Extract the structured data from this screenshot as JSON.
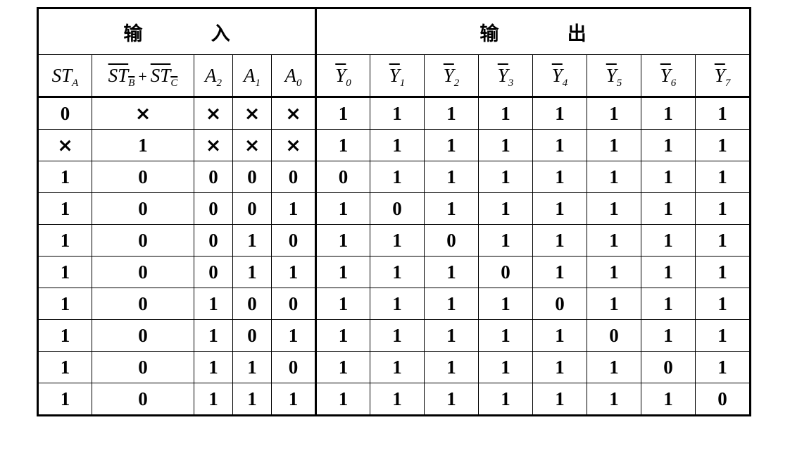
{
  "groups": {
    "input": "输 入",
    "output": "输 出"
  },
  "headers": {
    "st_a": {
      "main": "ST",
      "sub": "A"
    },
    "st_bc": {
      "left_main": "ST",
      "left_sub": "B",
      "plus": "+",
      "right_main": "ST",
      "right_sub": "C"
    },
    "a2": {
      "main": "A",
      "sub": "2"
    },
    "a1": {
      "main": "A",
      "sub": "1"
    },
    "a0": {
      "main": "A",
      "sub": "0"
    },
    "outputs": [
      {
        "main": "Y",
        "sub": "0"
      },
      {
        "main": "Y",
        "sub": "1"
      },
      {
        "main": "Y",
        "sub": "2"
      },
      {
        "main": "Y",
        "sub": "3"
      },
      {
        "main": "Y",
        "sub": "4"
      },
      {
        "main": "Y",
        "sub": "5"
      },
      {
        "main": "Y",
        "sub": "6"
      },
      {
        "main": "Y",
        "sub": "7"
      }
    ]
  },
  "rows": [
    [
      "0",
      "×",
      "×",
      "×",
      "×",
      "1",
      "1",
      "1",
      "1",
      "1",
      "1",
      "1",
      "1"
    ],
    [
      "×",
      "1",
      "×",
      "×",
      "×",
      "1",
      "1",
      "1",
      "1",
      "1",
      "1",
      "1",
      "1"
    ],
    [
      "1",
      "0",
      "0",
      "0",
      "0",
      "0",
      "1",
      "1",
      "1",
      "1",
      "1",
      "1",
      "1"
    ],
    [
      "1",
      "0",
      "0",
      "0",
      "1",
      "1",
      "0",
      "1",
      "1",
      "1",
      "1",
      "1",
      "1"
    ],
    [
      "1",
      "0",
      "0",
      "1",
      "0",
      "1",
      "1",
      "0",
      "1",
      "1",
      "1",
      "1",
      "1"
    ],
    [
      "1",
      "0",
      "0",
      "1",
      "1",
      "1",
      "1",
      "1",
      "0",
      "1",
      "1",
      "1",
      "1"
    ],
    [
      "1",
      "0",
      "1",
      "0",
      "0",
      "1",
      "1",
      "1",
      "1",
      "0",
      "1",
      "1",
      "1"
    ],
    [
      "1",
      "0",
      "1",
      "0",
      "1",
      "1",
      "1",
      "1",
      "1",
      "1",
      "0",
      "1",
      "1"
    ],
    [
      "1",
      "0",
      "1",
      "1",
      "0",
      "1",
      "1",
      "1",
      "1",
      "1",
      "1",
      "0",
      "1"
    ],
    [
      "1",
      "0",
      "1",
      "1",
      "1",
      "1",
      "1",
      "1",
      "1",
      "1",
      "1",
      "1",
      "0"
    ]
  ]
}
